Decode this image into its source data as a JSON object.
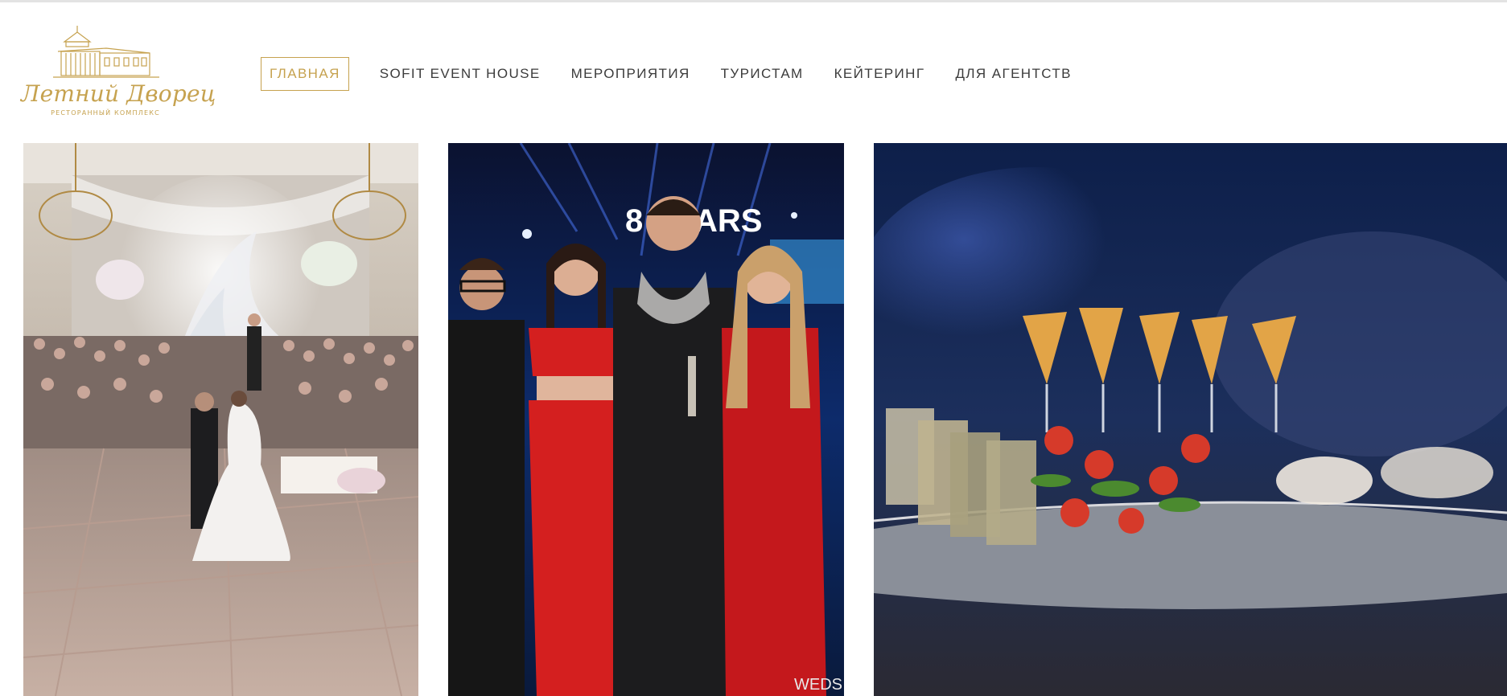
{
  "logo": {
    "name": "Летний Дворец",
    "tagline": "РЕСТОРАННЫЙ КОМПЛЕКС"
  },
  "nav": {
    "items": [
      {
        "label": "ГЛАВНАЯ",
        "active": true
      },
      {
        "label": "SOFIT EVENT HOUSE",
        "active": false
      },
      {
        "label": "МЕРОПРИЯТИЯ",
        "active": false
      },
      {
        "label": "ТУРИСТАМ",
        "active": false
      },
      {
        "label": "КЕЙТЕРИНГ",
        "active": false
      },
      {
        "label": "ДЛЯ АГЕНТСТВ",
        "active": false
      }
    ]
  },
  "gallery": {
    "tiles": [
      {
        "subject": "wedding-ceremony-hall"
      },
      {
        "subject": "party-guests-stage-signage",
        "stage_text": "8 YEARS",
        "watermark": "WEDS"
      },
      {
        "subject": "catering-appetizers-tray"
      }
    ]
  },
  "colors": {
    "accent_gold": "#c6a24f",
    "nav_text": "#3b3b3b",
    "background": "#ffffff"
  }
}
